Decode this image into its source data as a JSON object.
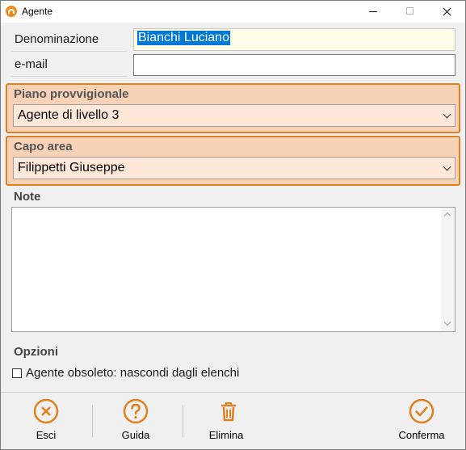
{
  "window": {
    "title": "Agente"
  },
  "fields": {
    "denominazione_label": "Denominazione",
    "denominazione_value": "Bianchi Luciano",
    "email_label": "e-mail",
    "email_value": ""
  },
  "piano": {
    "label": "Piano provvigionale",
    "value": "Agente di livello 3"
  },
  "capo": {
    "label": "Capo area",
    "value": "Filippetti Giuseppe"
  },
  "note": {
    "label": "Note",
    "value": ""
  },
  "opzioni": {
    "label": "Opzioni",
    "checkbox_label": "Agente obsoleto: nascondi dagli elenchi",
    "checked": false
  },
  "toolbar": {
    "esci": "Esci",
    "guida": "Guida",
    "elimina": "Elimina",
    "conferma": "Conferma"
  },
  "colors": {
    "accent": "#e0801f",
    "group_bg": "#f8d2b6",
    "combo_bg": "#fee8da"
  }
}
